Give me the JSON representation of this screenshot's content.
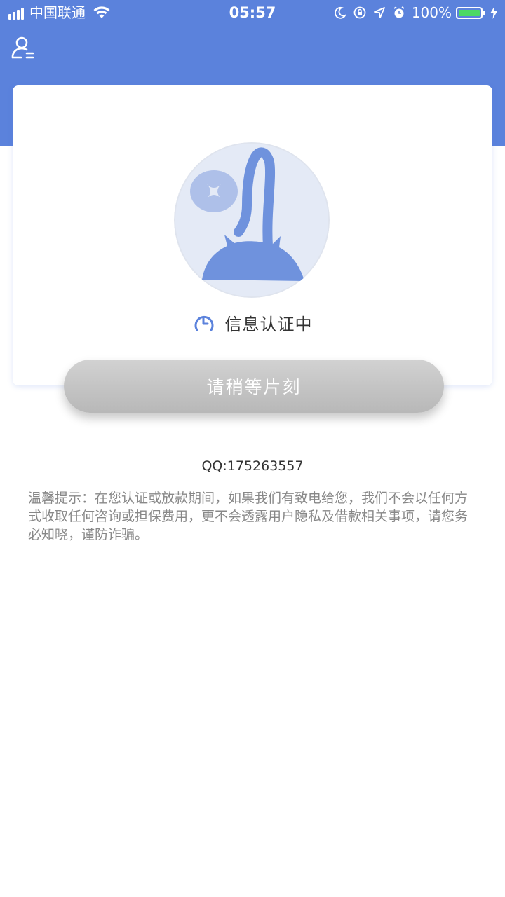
{
  "status_bar": {
    "carrier": "中国联通",
    "time": "05:57",
    "battery": "100%"
  },
  "colors": {
    "header": "#5b82dc",
    "button": "#c6c6c6",
    "battery": "#4cd964"
  },
  "header": {
    "user_icon": "user-menu-icon"
  },
  "card": {
    "illustration": "money-bag-icon",
    "status_icon": "clock-icon",
    "status_text": "信息认证中"
  },
  "button": {
    "label": "请稍等片刻"
  },
  "contact": {
    "qq": "QQ:175263557"
  },
  "tip": {
    "text": "温馨提示：在您认证或放款期间，如果我们有致电给您，我们不会以任何方式收取任何咨询或担保费用，更不会透露用户隐私及借款相关事项，请您务必知晓，谨防诈骗。"
  }
}
